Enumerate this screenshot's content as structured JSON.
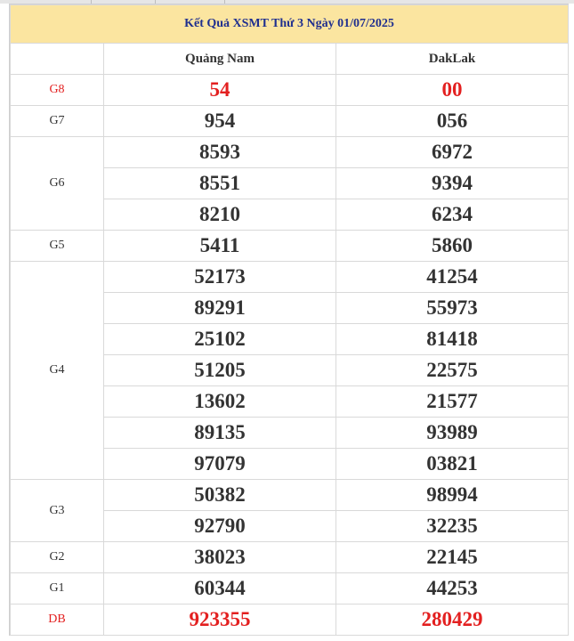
{
  "title": "Kết Quả XSMT Thứ 3 Ngày 01/07/2025",
  "provinces": [
    "Quảng Nam",
    "DakLak"
  ],
  "prizes": [
    {
      "label": "G8",
      "quang_nam": [
        "54"
      ],
      "daklak": [
        "00"
      ]
    },
    {
      "label": "G7",
      "quang_nam": [
        "954"
      ],
      "daklak": [
        "056"
      ]
    },
    {
      "label": "G6",
      "quang_nam": [
        "8593",
        "8551",
        "8210"
      ],
      "daklak": [
        "6972",
        "9394",
        "6234"
      ]
    },
    {
      "label": "G5",
      "quang_nam": [
        "5411"
      ],
      "daklak": [
        "5860"
      ]
    },
    {
      "label": "G4",
      "quang_nam": [
        "52173",
        "89291",
        "25102",
        "51205",
        "13602",
        "89135",
        "97079"
      ],
      "daklak": [
        "41254",
        "55973",
        "81418",
        "22575",
        "21577",
        "93989",
        "03821"
      ]
    },
    {
      "label": "G3",
      "quang_nam": [
        "50382",
        "92790"
      ],
      "daklak": [
        "98994",
        "32235"
      ]
    },
    {
      "label": "G2",
      "quang_nam": [
        "38023"
      ],
      "daklak": [
        "22145"
      ]
    },
    {
      "label": "G1",
      "quang_nam": [
        "60344"
      ],
      "daklak": [
        "44253"
      ]
    },
    {
      "label": "DB",
      "quang_nam": [
        "923355"
      ],
      "daklak": [
        "280429"
      ]
    }
  ],
  "colors": {
    "highlight": "#e32020",
    "header_bg": "#fbe5a0",
    "title_text": "#1f2f8f"
  }
}
